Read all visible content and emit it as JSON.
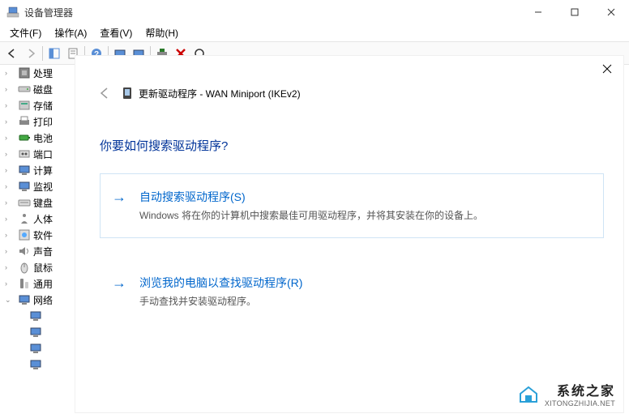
{
  "titlebar": {
    "title": "设备管理器"
  },
  "menubar": {
    "file": "文件(F)",
    "action": "操作(A)",
    "view": "查看(V)",
    "help": "帮助(H)"
  },
  "tree": {
    "items": [
      {
        "label": "处理",
        "exp": ">"
      },
      {
        "label": "磁盘",
        "exp": ">"
      },
      {
        "label": "存储",
        "exp": ">"
      },
      {
        "label": "打印",
        "exp": ">"
      },
      {
        "label": "电池",
        "exp": ">"
      },
      {
        "label": "端口",
        "exp": ">"
      },
      {
        "label": "计算",
        "exp": ">"
      },
      {
        "label": "监视",
        "exp": ">"
      },
      {
        "label": "键盘",
        "exp": ">"
      },
      {
        "label": "人体",
        "exp": ">"
      },
      {
        "label": "软件",
        "exp": ">"
      },
      {
        "label": "声音",
        "exp": ">"
      },
      {
        "label": "鼠标",
        "exp": ">"
      },
      {
        "label": "通用",
        "exp": ">"
      },
      {
        "label": "网络",
        "exp": "v"
      }
    ]
  },
  "dialog": {
    "headline": "更新驱动程序 - WAN Miniport (IKEv2)",
    "question": "你要如何搜索驱动程序?",
    "option1": {
      "title": "自动搜索驱动程序(S)",
      "desc": "Windows 将在你的计算机中搜索最佳可用驱动程序，并将其安装在你的设备上。"
    },
    "option2": {
      "title": "浏览我的电脑以查找驱动程序(R)",
      "desc": "手动查找并安装驱动程序。"
    }
  },
  "watermark": {
    "cn": "系统之家",
    "url": "XITONGZHIJIA.NET"
  }
}
